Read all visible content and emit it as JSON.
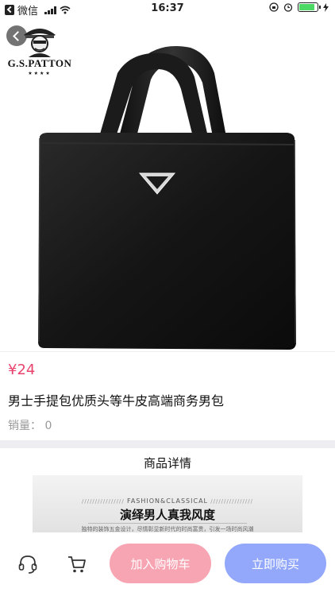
{
  "status_bar": {
    "app": "微信",
    "time": "16:37",
    "battery_percent": 85
  },
  "brand": {
    "name": "G.S.PATTON",
    "stars": "★★★★"
  },
  "product": {
    "price": "¥24",
    "title": "男士手提包优质头等牛皮高端商务男包",
    "sales": "销量：  0"
  },
  "details": {
    "title": "商品详情",
    "banner_sub": "FASHION&CLASSICAL",
    "banner_main": "演绎男人真我风度",
    "banner_small": "独特的装饰五金设计，尽情彰显新时代的时尚富贵，引发一场时尚风潮"
  },
  "actions": {
    "add_to_cart": "加入购物车",
    "buy_now": "立即购买"
  },
  "colors": {
    "price": "#e9436d",
    "cart_button": "#f7a4b3",
    "buy_button": "#93a8fb"
  }
}
